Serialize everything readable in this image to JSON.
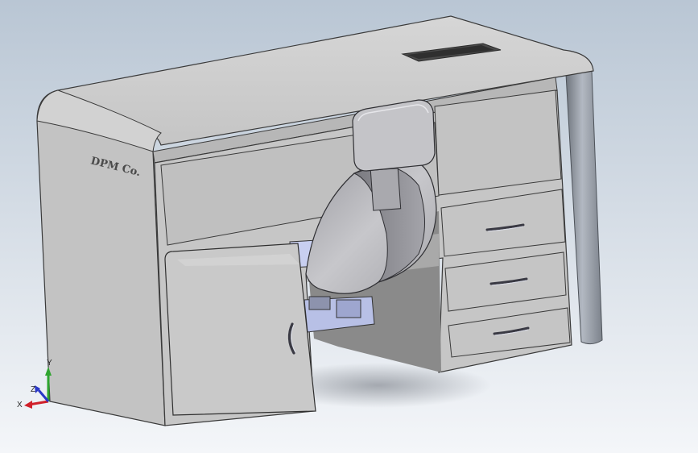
{
  "viewport": {
    "background_top": "#b9c6d4",
    "background_bottom": "#f4f6f9"
  },
  "model": {
    "engraving": "DPM Co.",
    "colors": {
      "cabinet": "#c9c9c9",
      "cabinet_dark": "#9a9a9a",
      "chair_seat": "#b8b8bc",
      "chair_shell": "#8e8e94",
      "pipe": "#9ea4ad",
      "mechanism": "#b8c0e6"
    }
  },
  "triad": {
    "x_label": "X",
    "y_label": "Y",
    "z_label": "Z",
    "x_color": "#d0202a",
    "y_color": "#2fa52f",
    "z_color": "#2a38c8"
  }
}
